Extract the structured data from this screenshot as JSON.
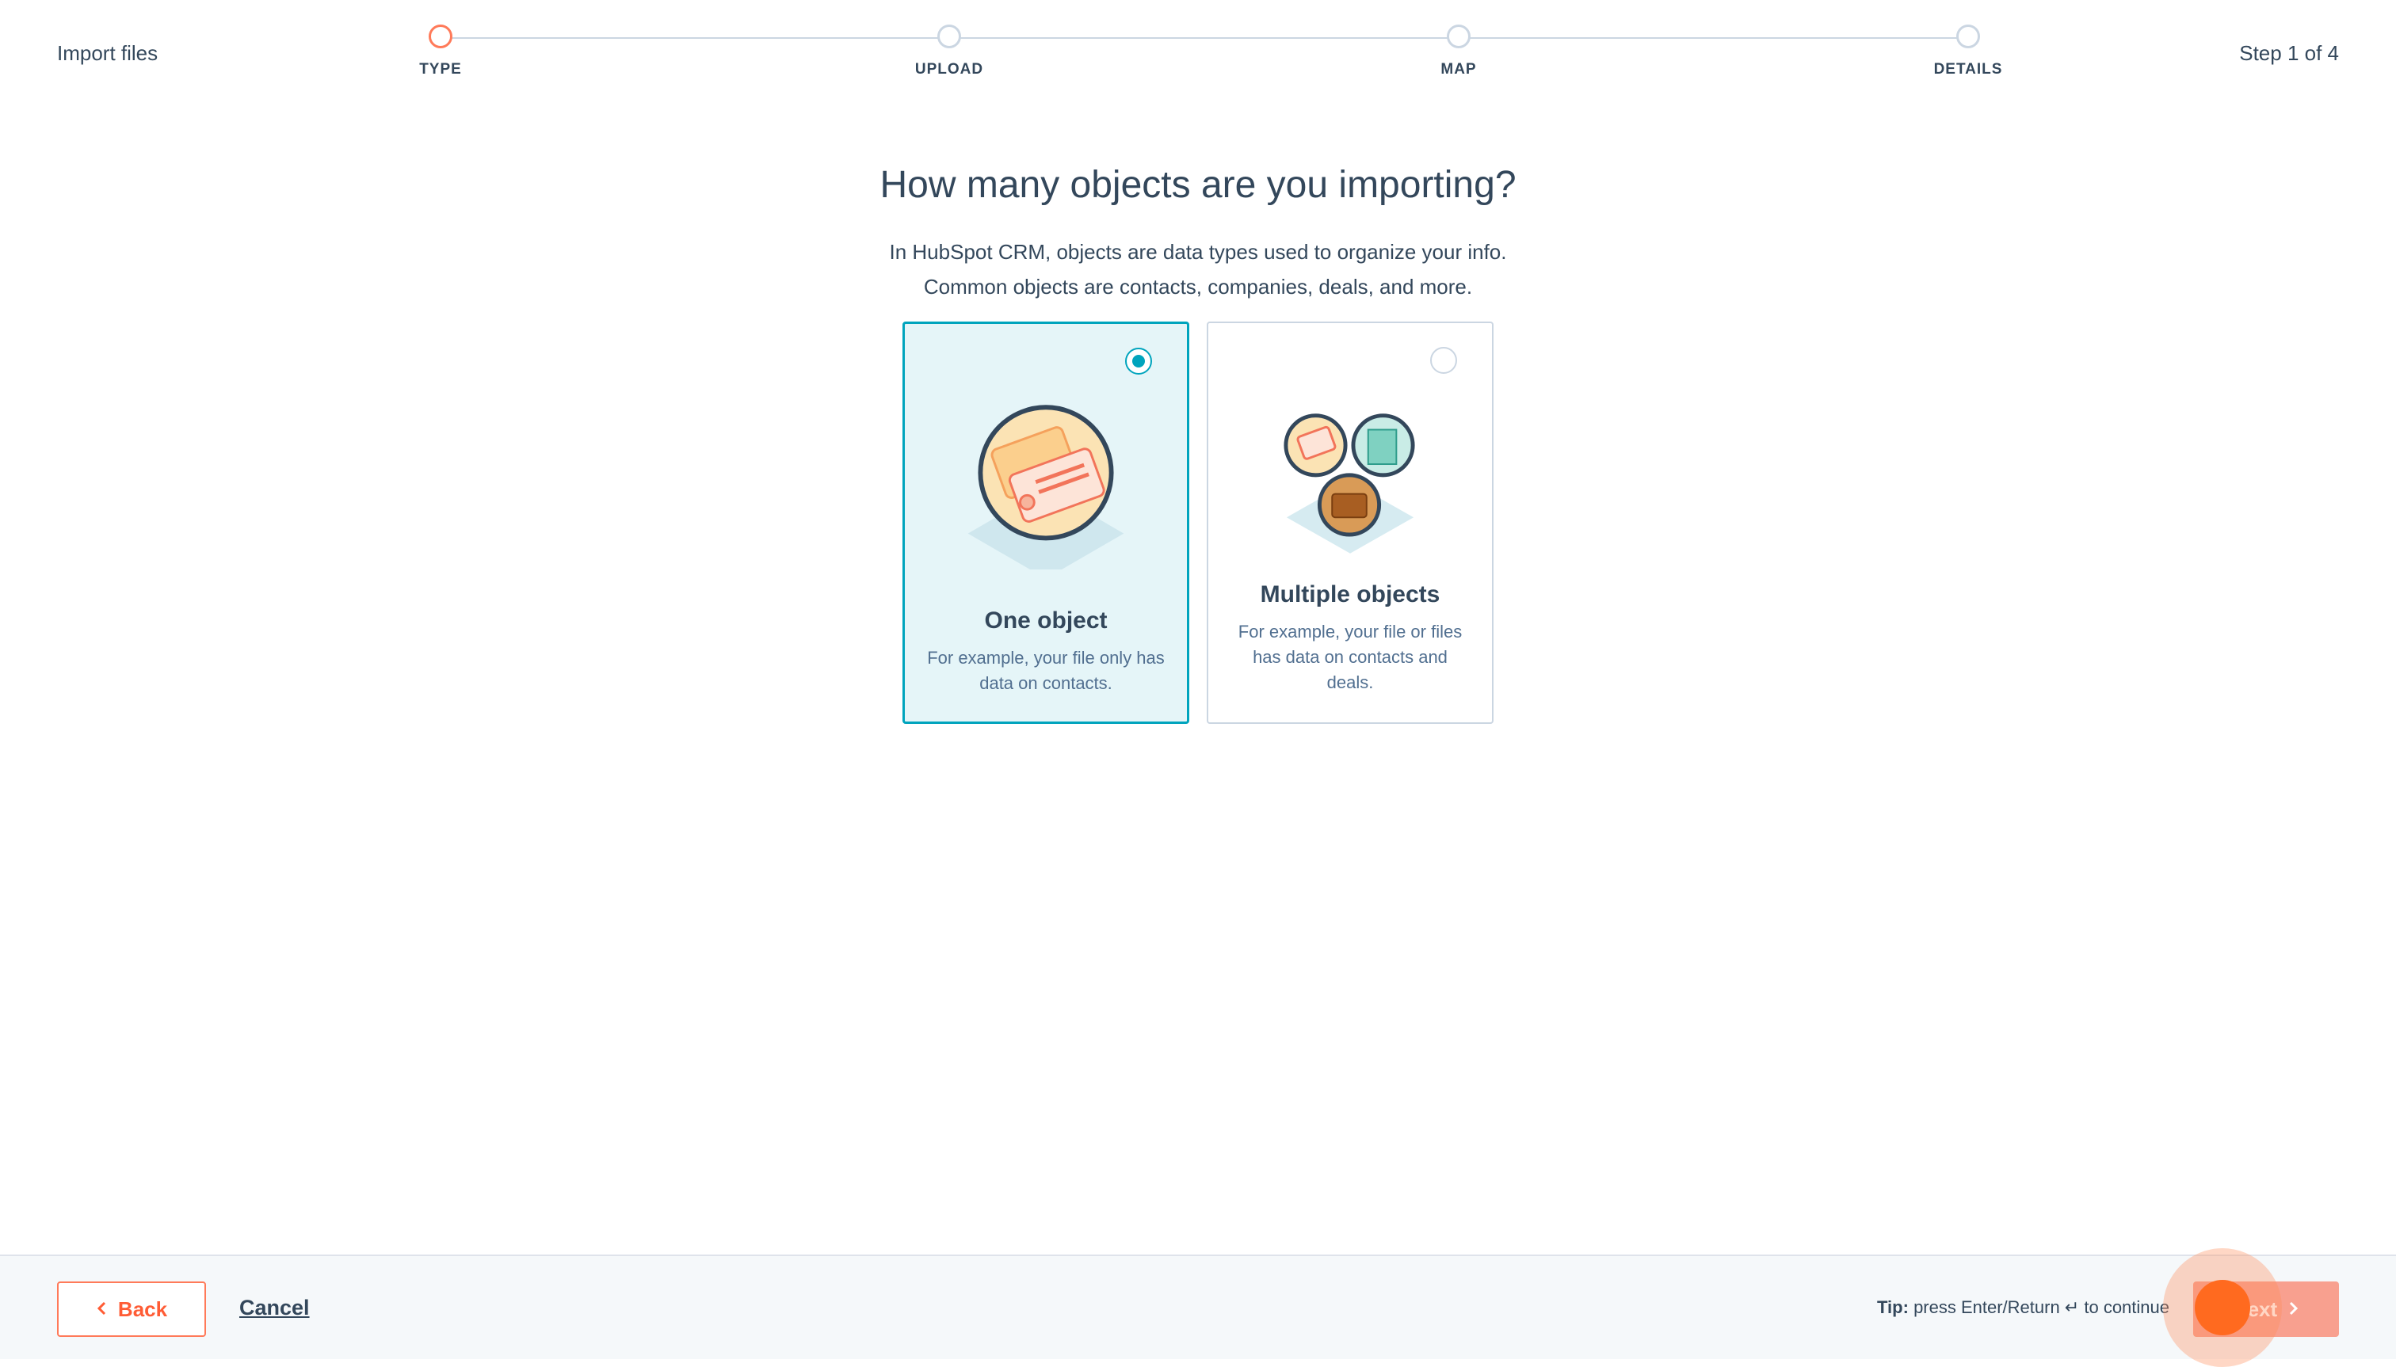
{
  "header": {
    "title": "Import files",
    "step_indicator": "Step 1 of 4"
  },
  "stepper": {
    "steps": [
      {
        "label": "TYPE",
        "state": "active"
      },
      {
        "label": "UPLOAD",
        "state": "pending"
      },
      {
        "label": "MAP",
        "state": "pending"
      },
      {
        "label": "DETAILS",
        "state": "pending"
      }
    ]
  },
  "main": {
    "heading": "How many objects are you importing?",
    "description_line1": "In HubSpot CRM, objects are data types used to organize your info.",
    "description_line2": "Common objects are contacts, companies, deals, and more.",
    "options": [
      {
        "title": "One object",
        "description": "For example, your file only has data on contacts.",
        "selected": true,
        "icon": "contact-card-illustration"
      },
      {
        "title": "Multiple objects",
        "description": "For example, your file or files has data on contacts and deals.",
        "selected": false,
        "icon": "multiple-objects-illustration"
      }
    ]
  },
  "footer": {
    "back_label": "Back",
    "cancel_label": "Cancel",
    "tip_prefix": "Tip:",
    "tip_text": "press Enter/Return ↵ to continue",
    "next_label": "Next"
  },
  "colors": {
    "accent": "#ff7a59",
    "selected_border": "#00a4bd",
    "selected_bg": "#e5f5f8",
    "text": "#33475b"
  }
}
